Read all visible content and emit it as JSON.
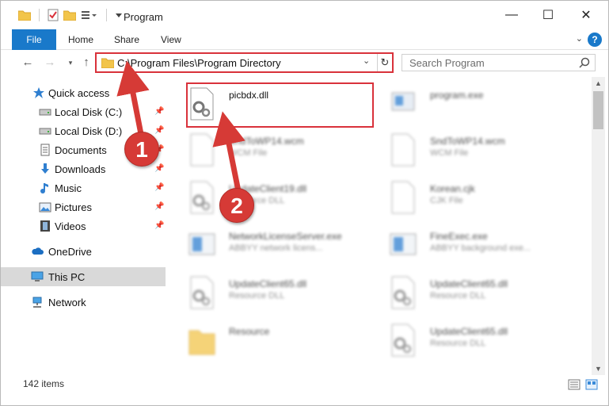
{
  "window": {
    "title": "Program",
    "controls": {
      "minimize": "—",
      "maximize": "☐",
      "close": "✕"
    }
  },
  "ribbon": {
    "tabs": [
      "File",
      "Home",
      "Share",
      "View"
    ]
  },
  "address": {
    "path": "C:\\Program Files\\Program Directory",
    "search_placeholder": "Search Program"
  },
  "sidebar": {
    "items": [
      {
        "label": "Quick access",
        "icon": "star-icon",
        "pinned": false
      },
      {
        "label": "Local Disk (C:)",
        "icon": "drive-icon",
        "pinned": true
      },
      {
        "label": "Local Disk (D:)",
        "icon": "drive-icon",
        "pinned": true
      },
      {
        "label": "Documents",
        "icon": "documents-icon",
        "pinned": true
      },
      {
        "label": "Downloads",
        "icon": "download-arrow-icon",
        "pinned": true
      },
      {
        "label": "Music",
        "icon": "music-note-icon",
        "pinned": true
      },
      {
        "label": "Pictures",
        "icon": "pictures-icon",
        "pinned": true
      },
      {
        "label": "Videos",
        "icon": "film-icon",
        "pinned": true
      },
      {
        "label": "OneDrive",
        "icon": "cloud-icon",
        "pinned": false
      },
      {
        "label": "This PC",
        "icon": "computer-icon",
        "pinned": false,
        "selected": true
      },
      {
        "label": "Network",
        "icon": "network-icon",
        "pinned": false
      }
    ]
  },
  "files": [
    {
      "name": "picbdx.dll",
      "type": "",
      "icon": "dll-gear-icon",
      "highlighted": true
    },
    {
      "name": "program.exe",
      "type": "",
      "icon": "exe-icon"
    },
    {
      "name": "SndToWP14.wcm",
      "type": "WCM File",
      "icon": "blank-file-icon"
    },
    {
      "name": "SndToWP14.wcm",
      "type": "WCM File",
      "icon": "blank-file-icon"
    },
    {
      "name": "UpdateClient19.dll",
      "type": "Resource DLL",
      "icon": "dll-gear-icon"
    },
    {
      "name": "Korean.cjk",
      "type": "CJK File",
      "icon": "blank-file-icon"
    },
    {
      "name": "NetworkLicenseServer.exe",
      "type": "ABBYY network licens...",
      "icon": "app-window-icon"
    },
    {
      "name": "FineExec.exe",
      "type": "ABBYY background exe...",
      "icon": "app-window-icon"
    },
    {
      "name": "UpdateClient65.dll",
      "type": "Resource DLL",
      "icon": "dll-gear-icon"
    },
    {
      "name": "UpdateClient65.dll",
      "type": "Resource DLL",
      "icon": "dll-gear-icon"
    },
    {
      "name": "Resource",
      "type": "",
      "icon": "folder-icon"
    },
    {
      "name": "UpdateClient65.dll",
      "type": "Resource DLL",
      "icon": "dll-gear-icon"
    }
  ],
  "status": {
    "count": "142 items"
  },
  "annotations": {
    "marker1": "1",
    "marker2": "2"
  },
  "colors": {
    "accent": "#1979ca",
    "annotation_red": "#d9323b",
    "selected_bg": "#d9d9d9"
  }
}
